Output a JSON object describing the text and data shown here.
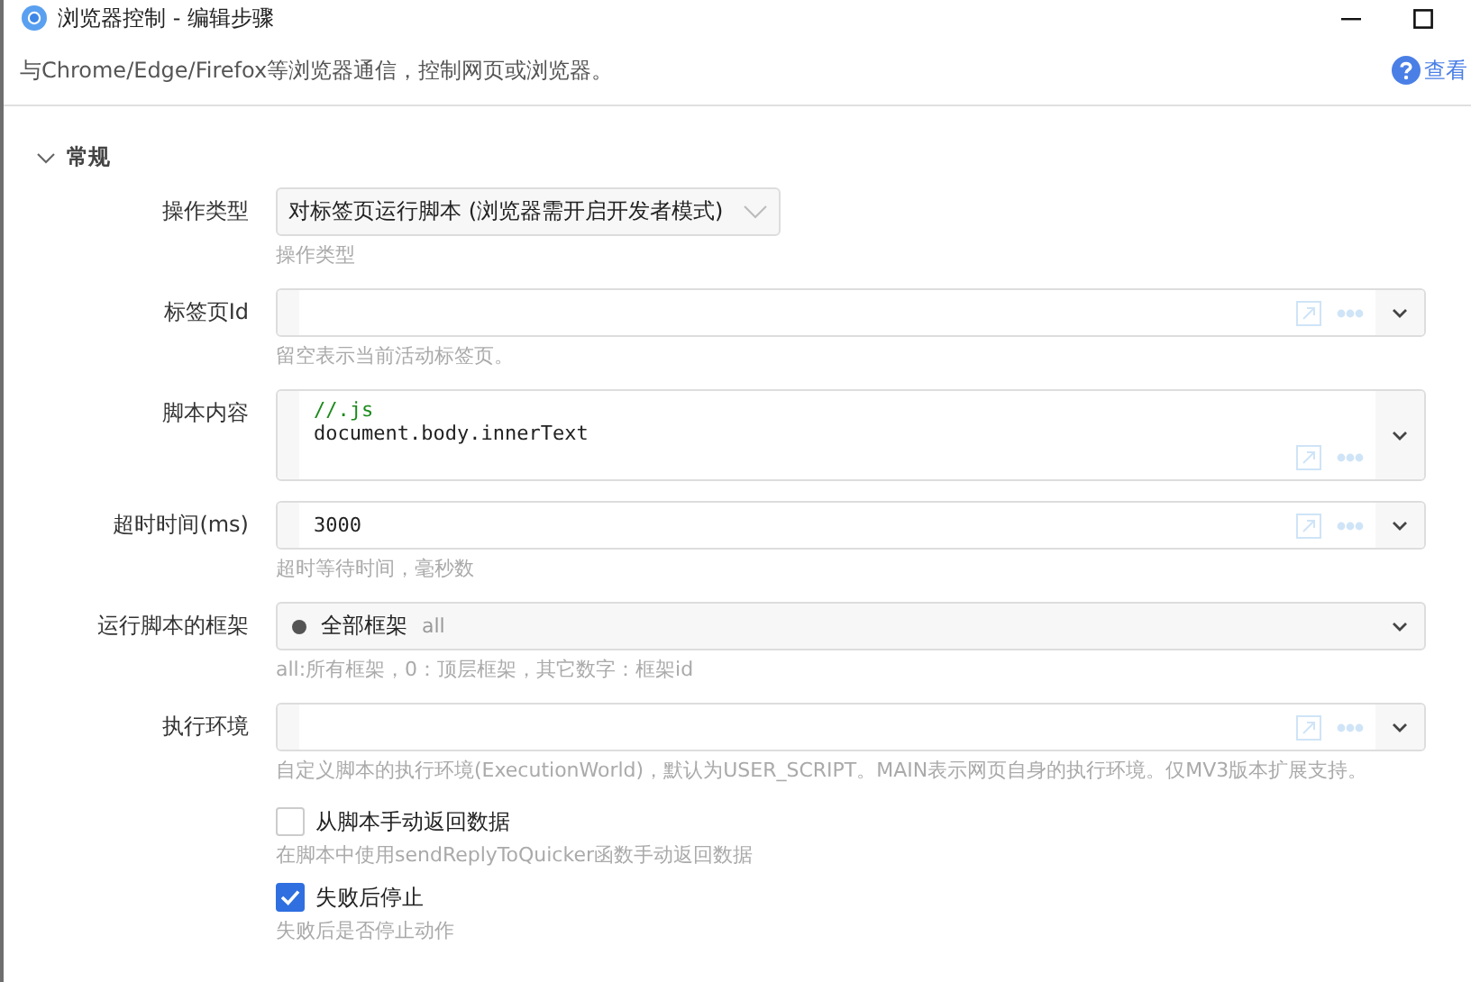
{
  "window": {
    "title": "浏览器控制  -  编辑步骤"
  },
  "description": "与Chrome/Edge/Firefox等浏览器通信，控制网页或浏览器。",
  "help_link": "查看",
  "section": {
    "title": "常规",
    "expanded": true
  },
  "fields": [
    {
      "kind": "select",
      "label": "操作类型",
      "value": "对标签页运行脚本 (浏览器需开启开发者模式)",
      "hint": "操作类型"
    },
    {
      "kind": "text",
      "label": "标签页Id",
      "hint": "留空表示当前活动标签页。"
    },
    {
      "kind": "code",
      "label": "脚本内容",
      "lines": [
        {
          "kind": "comment",
          "text": "//.js"
        },
        {
          "kind": "plain",
          "text": "document.body.innerText"
        }
      ]
    },
    {
      "kind": "text",
      "label": "超时时间(ms)",
      "value": "3000",
      "hint": "超时等待时间，毫秒数"
    },
    {
      "kind": "option",
      "label": "运行脚本的框架",
      "value": "全部框架",
      "note": "all",
      "hint": "all:所有框架，0：顶层框架，其它数字：框架id"
    },
    {
      "kind": "text",
      "label": "执行环境",
      "hint": "自定义脚本的执行环境(ExecutionWorld)，默认为USER_SCRIPT。MAIN表示网页自身的执行环境。仅MV3版本扩展支持。"
    },
    {
      "kind": "checkbox",
      "label": "从脚本手动返回数据",
      "checked": false,
      "hint": "在脚本中使用sendReplyToQuicker函数手动返回数据"
    },
    {
      "kind": "checkbox",
      "label": "失败后停止",
      "checked": true,
      "hint": "失败后是否停止动作"
    }
  ]
}
